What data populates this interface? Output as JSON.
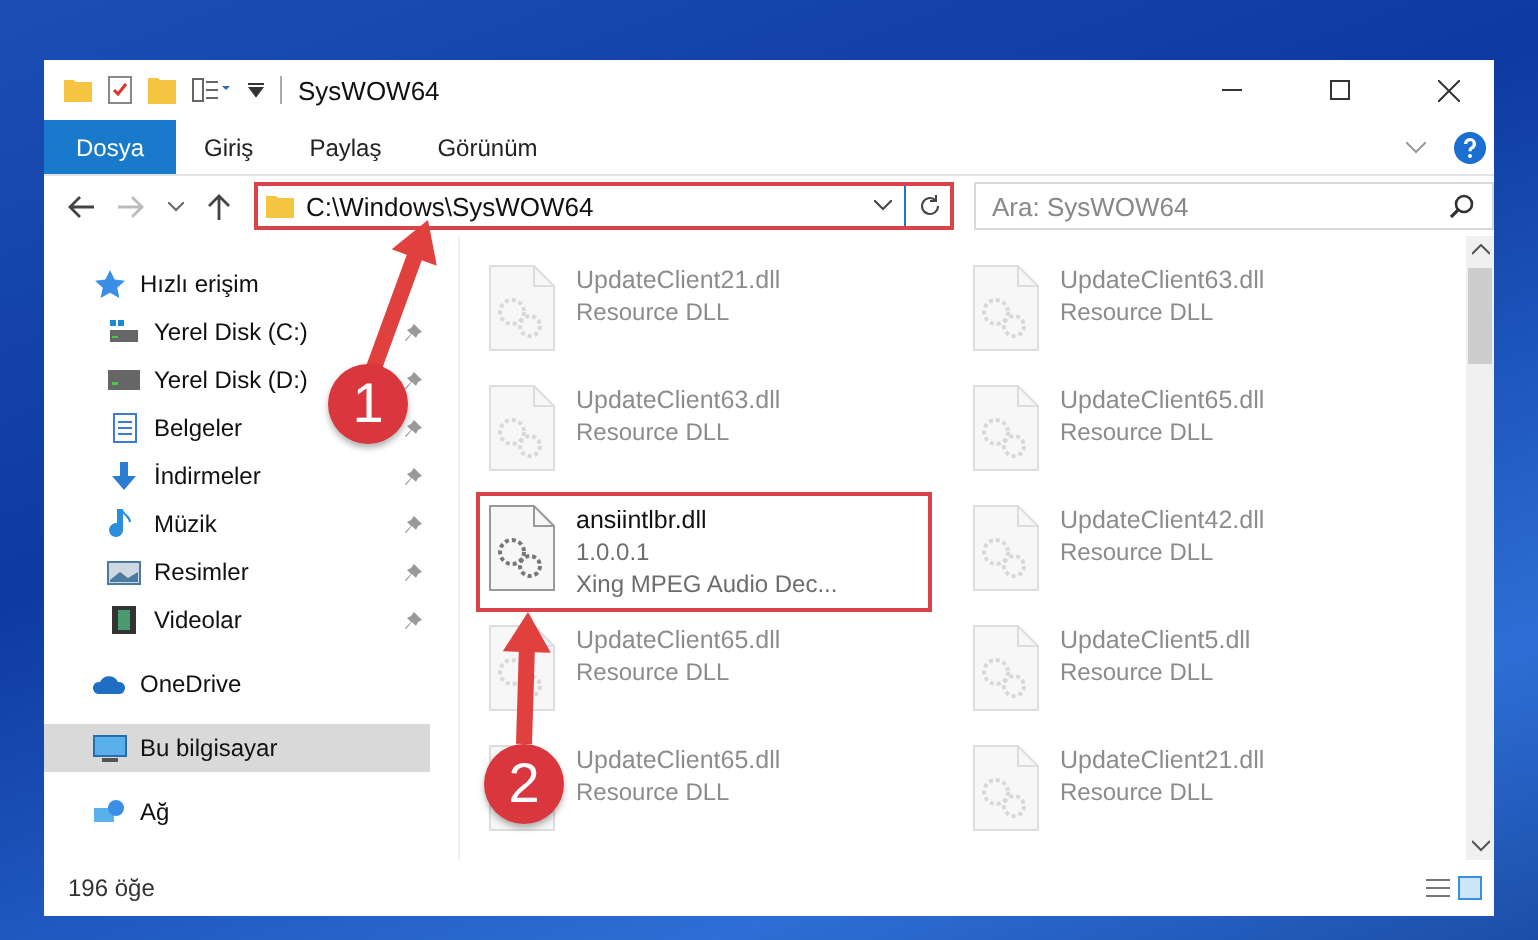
{
  "window": {
    "title": "SysWOW64"
  },
  "ribbon_tabs": [
    {
      "label": "Dosya",
      "kind": "file"
    },
    {
      "label": "Giriş",
      "kind": "tab"
    },
    {
      "label": "Paylaş",
      "kind": "tab"
    },
    {
      "label": "Görünüm",
      "kind": "tab"
    }
  ],
  "address_bar": {
    "path": "C:\\Windows\\SysWOW64",
    "highlighted": true
  },
  "search": {
    "placeholder": "Ara: SysWOW64"
  },
  "sidebar": {
    "items": [
      {
        "label": "Hızlı erişim",
        "pinned": false,
        "selected": false,
        "kind": "section"
      },
      {
        "label": "Yerel Disk (C:)",
        "pinned": true,
        "selected": false,
        "kind": "subitem"
      },
      {
        "label": "Yerel Disk (D:)",
        "pinned": true,
        "selected": false,
        "kind": "subitem"
      },
      {
        "label": "Belgeler",
        "pinned": true,
        "selected": false,
        "kind": "subitem"
      },
      {
        "label": "İndirmeler",
        "pinned": true,
        "selected": false,
        "kind": "subitem"
      },
      {
        "label": "Müzik",
        "pinned": true,
        "selected": false,
        "kind": "subitem"
      },
      {
        "label": "Resimler",
        "pinned": true,
        "selected": false,
        "kind": "subitem"
      },
      {
        "label": "Videolar",
        "pinned": true,
        "selected": false,
        "kind": "subitem"
      },
      {
        "label": "OneDrive",
        "pinned": false,
        "selected": false,
        "kind": "section"
      },
      {
        "label": "Bu bilgisayar",
        "pinned": false,
        "selected": true,
        "kind": "section"
      },
      {
        "label": "Ağ",
        "pinned": false,
        "selected": false,
        "kind": "section"
      }
    ]
  },
  "files": [
    {
      "lines": [
        "UpdateClient21.dll",
        "Resource DLL"
      ],
      "dimmed": true,
      "highlighted": false
    },
    {
      "lines": [
        "UpdateClient63.dll",
        "Resource DLL"
      ],
      "dimmed": true,
      "highlighted": false
    },
    {
      "lines": [
        "UpdateClient63.dll",
        "Resource DLL"
      ],
      "dimmed": true,
      "highlighted": false
    },
    {
      "lines": [
        "UpdateClient65.dll",
        "Resource DLL"
      ],
      "dimmed": true,
      "highlighted": false
    },
    {
      "lines": [
        "ansiintlbr.dll",
        "1.0.0.1",
        "Xing MPEG Audio Dec..."
      ],
      "dimmed": false,
      "highlighted": true
    },
    {
      "lines": [
        "UpdateClient42.dll",
        "Resource DLL"
      ],
      "dimmed": true,
      "highlighted": false
    },
    {
      "lines": [
        "UpdateClient65.dll",
        "Resource DLL"
      ],
      "dimmed": true,
      "highlighted": false
    },
    {
      "lines": [
        "UpdateClient5.dll",
        "Resource DLL"
      ],
      "dimmed": true,
      "highlighted": false
    },
    {
      "lines": [
        "UpdateClient65.dll",
        "Resource DLL"
      ],
      "dimmed": true,
      "highlighted": false
    },
    {
      "lines": [
        "UpdateClient21.dll",
        "Resource DLL"
      ],
      "dimmed": true,
      "highlighted": false
    }
  ],
  "status_bar": {
    "count": "196 öğe"
  },
  "annotations": [
    {
      "number": "1"
    },
    {
      "number": "2"
    }
  ]
}
